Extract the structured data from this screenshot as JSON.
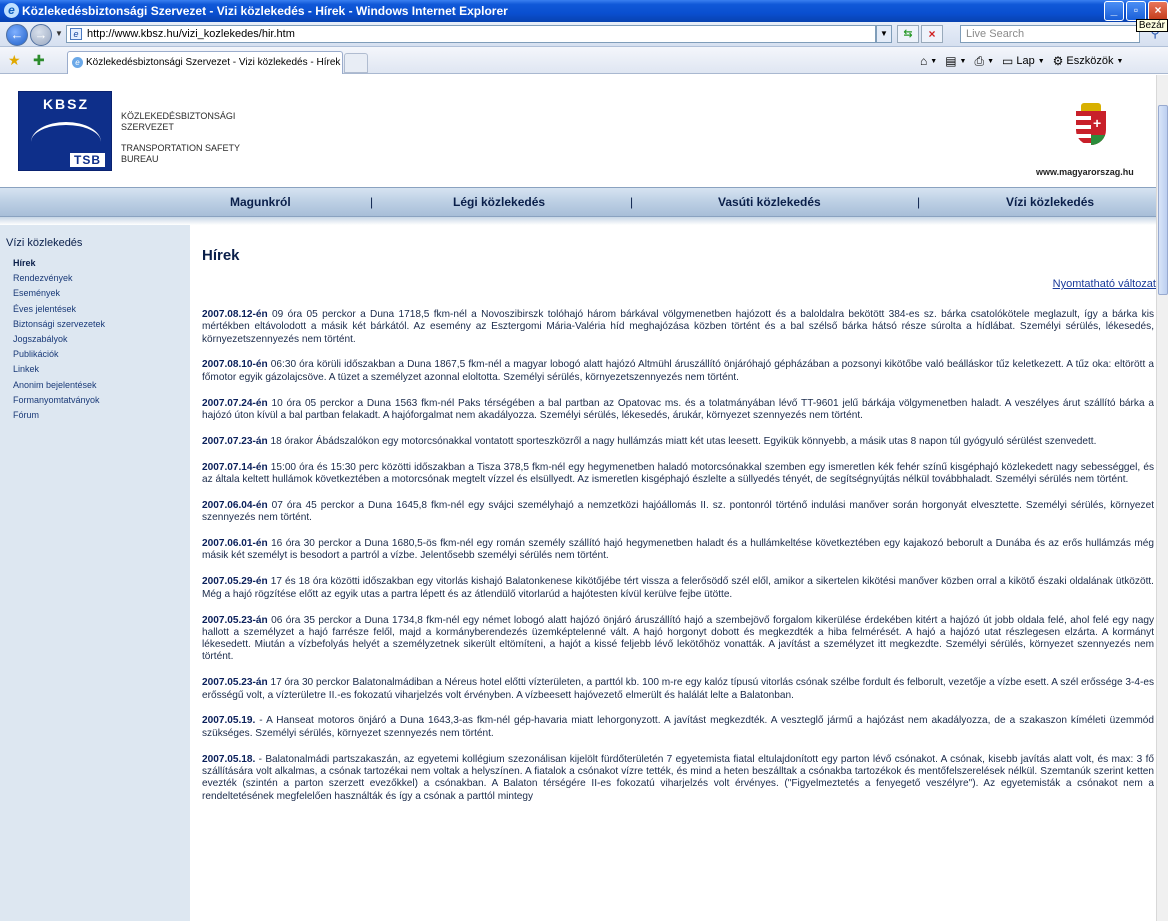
{
  "window": {
    "title": "Közlekedésbiztonsági Szervezet - Vizi közlekedés - Hírek - Windows Internet Explorer",
    "tooltip": "Bezár"
  },
  "browser": {
    "address": "http://www.kbsz.hu/vizi_kozlekedes/hir.htm",
    "search_placeholder": "Live Search",
    "tab_title": "Közlekedésbiztonsági Szervezet - Vizi közlekedés - Hírek",
    "commands": {
      "page": "Lap",
      "tools": "Eszközök"
    }
  },
  "header": {
    "logo_top": "KBSZ",
    "logo_bottom": "TSB",
    "org_hu_1": "KÖZLEKEDÉSBIZTONSÁGI",
    "org_hu_2": "SZERVEZET",
    "org_en_1": "TRANSPORTATION SAFETY",
    "org_en_2": "BUREAU",
    "gov_site": "www.magyarorszag.hu"
  },
  "nav": {
    "items": [
      "Magunkról",
      "Légi közlekedés",
      "Vasúti közlekedés",
      "Vízi közlekedés"
    ],
    "separator": "|"
  },
  "sidebar": {
    "heading": "Vízi közlekedés",
    "items": [
      "Hírek",
      "Rendezvények",
      "Események",
      "Éves jelentések",
      "Biztonsági szervezetek",
      "Jogszabályok",
      "Publikációk",
      "Linkek",
      "Anonim bejelentések",
      "Formanyomtatványok",
      "Fórum"
    ]
  },
  "main": {
    "title": "Hírek",
    "print_link": "Nyomtatható változat"
  },
  "news": [
    {
      "date": "2007.08.12-én",
      "text": " 09 óra 05 perckor a Duna 1718,5 fkm-nél a Novoszibirszk tolóhajó három bárkával völgymenetben hajózott és a baloldalra bekötött 384-es sz. bárka csatolókötele meglazult, így a bárka kis mértékben eltávolodott a másik két bárkától. Az esemény az Esztergomi Mária-Valéria híd meghajózása közben történt és a bal szélső bárka hátsó része súrolta a hídlábat. Személyi sérülés, lékesedés, környezetszennyezés nem történt."
    },
    {
      "date": "2007.08.10-én",
      "text": " 06:30 óra körüli időszakban a Duna 1867,5 fkm-nél a magyar lobogó alatt hajózó Altmühl áruszállító önjáróhajó gépházában a pozsonyi kikötőbe való beálláskor tűz keletkezett. A tűz oka: eltörött a főmotor egyik gázolajcsöve. A tüzet a személyzet azonnal eloltotta. Személyi sérülés, környezetszennyezés nem történt."
    },
    {
      "date": "2007.07.24-én",
      "text": " 10 óra 05 perckor a Duna 1563 fkm-nél Paks térségében a bal partban az Opatovac ms. és a tolatmányában lévő TT-9601 jelű bárkája völgymenetben haladt. A veszélyes árut szállító bárka a hajózó úton kívül a bal partban felakadt. A hajóforgalmat nem akadályozza. Személyi sérülés, lékesedés, árukár, környezet szennyezés nem történt."
    },
    {
      "date": "2007.07.23-án",
      "text": " 18 órakor Ábádszalókon egy motorcsónakkal vontatott sporteszközről a nagy hullámzás miatt két utas leesett. Egyikük könnyebb, a másik utas 8 napon túl gyógyuló sérülést szenvedett."
    },
    {
      "date": "2007.07.14-én",
      "text": " 15:00 óra és 15:30 perc közötti időszakban a Tisza 378,5 fkm-nél egy hegymenetben haladó motorcsónakkal szemben egy ismeretlen kék fehér színű kisgéphajó közlekedett nagy sebességgel, és az általa keltett hullámok következtében a motorcsónak megtelt vízzel és elsüllyedt. Az ismeretlen kisgéphajó észlelte a süllyedés tényét, de segítségnyújtás nélkül továbbhaladt. Személyi sérülés nem történt."
    },
    {
      "date": "2007.06.04-én",
      "text": " 07 óra 45 perckor a Duna 1645,8 fkm-nél egy svájci személyhajó a nemzetközi hajóállomás II. sz. pontonról történő indulási manőver során horgonyát elvesztette. Személyi sérülés, környezet szennyezés nem történt."
    },
    {
      "date": "2007.06.01-én",
      "text": " 16 óra 30 perckor a Duna 1680,5-ös fkm-nél egy román személy szállító hajó hegymenetben haladt és a hullámkeltése következtében egy kajakozó beborult a Dunába és az erős hullámzás még másik két személyt is besodort a partról a vízbe. Jelentősebb személyi sérülés nem történt."
    },
    {
      "date": "2007.05.29-én",
      "text": " 17 és 18 óra közötti időszakban egy vitorlás kishajó Balatonkenese kikötőjébe tért vissza a felerősödő szél elől, amikor a sikertelen kikötési manőver közben orral a kikötő északi oldalának ütközött. Még a hajó rögzítése előtt az egyik utas a partra lépett és az átlendülő vitorlarúd a hajótesten kívül kerülve fejbe ütötte."
    },
    {
      "date": "2007.05.23-án",
      "text": " 06 óra 35 perckor a Duna 1734,8 fkm-nél egy német lobogó alatt hajózó önjáró áruszállító hajó a szembejövő forgalom kikerülése érdekében kitért a hajózó út jobb oldala felé, ahol felé egy nagy hallott a személyzet a hajó farrésze felől, majd a kormányberendezés üzemképtelenné vált. A hajó horgonyt dobott és megkezdték a hiba felmérését. A hajó a hajózó utat részlegesen elzárta. A kormányt lékesedett. Miután a vízbefolyás helyét a személyzetnek sikerült eltömíteni, a hajót a kissé feljebb lévő lekötőhöz vonatták. A javítást a személyzet itt megkezdte. Személyi sérülés, környezet szennyezés nem történt."
    },
    {
      "date": "2007.05.23-án",
      "text": " 17 óra 30 perckor Balatonalmádiban a Néreus hotel előtti vízterületen, a parttól kb. 100 m-re egy kalóz típusú vitorlás csónak szélbe fordult és felborult, vezetője a vízbe esett. A szél erőssége 3-4-es erősségű volt, a vízterületre II.-es fokozatú viharjelzés volt érvényben. A vízbeesett hajóvezető elmerült és halálát lelte a Balatonban."
    },
    {
      "date": "2007.05.19.",
      "text": " - A Hanseat motoros önjáró a Duna 1643,3-as fkm-nél gép-havaria miatt lehorgonyzott. A javítást megkezdték. A veszteglő jármű a hajózást nem akadályozza, de a szakaszon kíméleti üzemmód szükséges. Személyi sérülés, környezet szennyezés nem történt."
    },
    {
      "date": "2007.05.18.",
      "text": " - Balatonalmádi partszakaszán, az egyetemi kollégium szezonálisan kijelölt fürdőterületén 7 egyetemista fiatal eltulajdonított egy parton lévő csónakot. A csónak, kisebb javítás alatt volt, és max: 3 fő szállítására volt alkalmas, a csónak tartozékai nem voltak a helyszínen. A fiatalok a csónakot vízre tették, és mind a heten beszálltak a csónakba tartozékok és mentőfelszerelések nélkül. Szemtanúk szerint ketten evezték (szintén a parton szerzett evezőkkel) a csónakban. A Balaton térségére II-es fokozatú viharjelzés volt érvényes. (\"Figyelmeztetés a fenyegető veszélyre\"). Az egyetemisták a csónakot nem a rendeltetésének megfelelően használták és így a csónak a parttól mintegy"
    }
  ]
}
